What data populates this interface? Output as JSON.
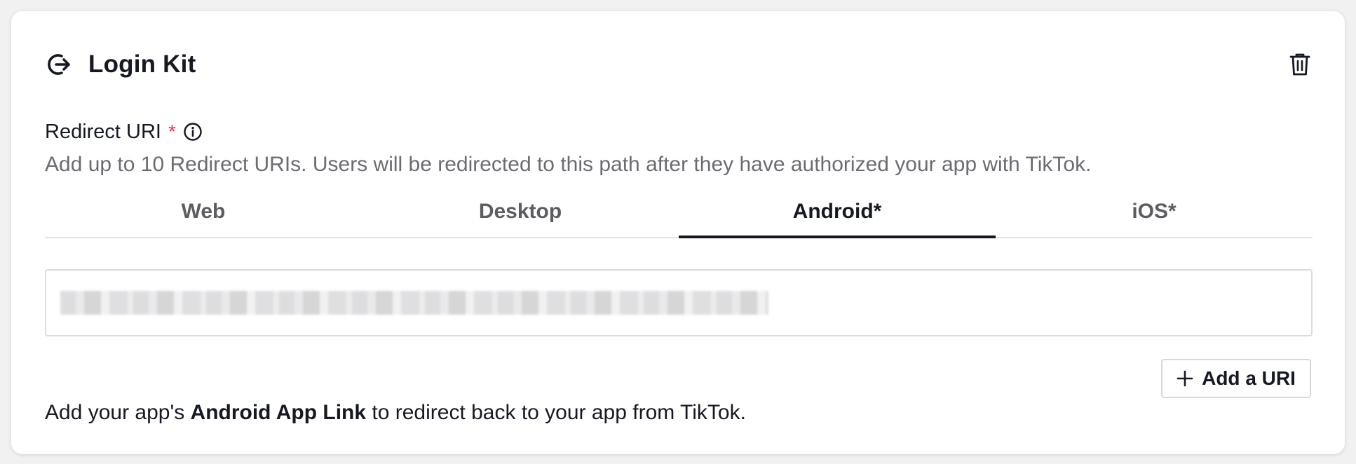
{
  "card": {
    "title": "Login Kit",
    "title_icon": "logout-arrow-icon",
    "delete_icon": "trash-icon"
  },
  "redirect": {
    "label": "Redirect URI",
    "required_mark": "*",
    "info_icon": "info-icon",
    "description": "Add up to 10 Redirect URIs. Users will be redirected to this path after they have authorized your app with TikTok."
  },
  "tabs": [
    {
      "label": "Web",
      "active": false
    },
    {
      "label": "Desktop",
      "active": false
    },
    {
      "label": "Android*",
      "active": true
    },
    {
      "label": "iOS*",
      "active": false
    }
  ],
  "uri_input": {
    "value": "",
    "value_redacted": true
  },
  "add_button": {
    "label": "Add a URI",
    "icon": "plus-icon"
  },
  "footer": {
    "prefix": "Add your app's ",
    "bold": "Android App Link",
    "suffix": " to redirect back to your app from TikTok."
  },
  "colors": {
    "required": "#fe2c55",
    "text": "#161823",
    "muted": "#6b6c72",
    "tab_indicator": "#161823"
  }
}
